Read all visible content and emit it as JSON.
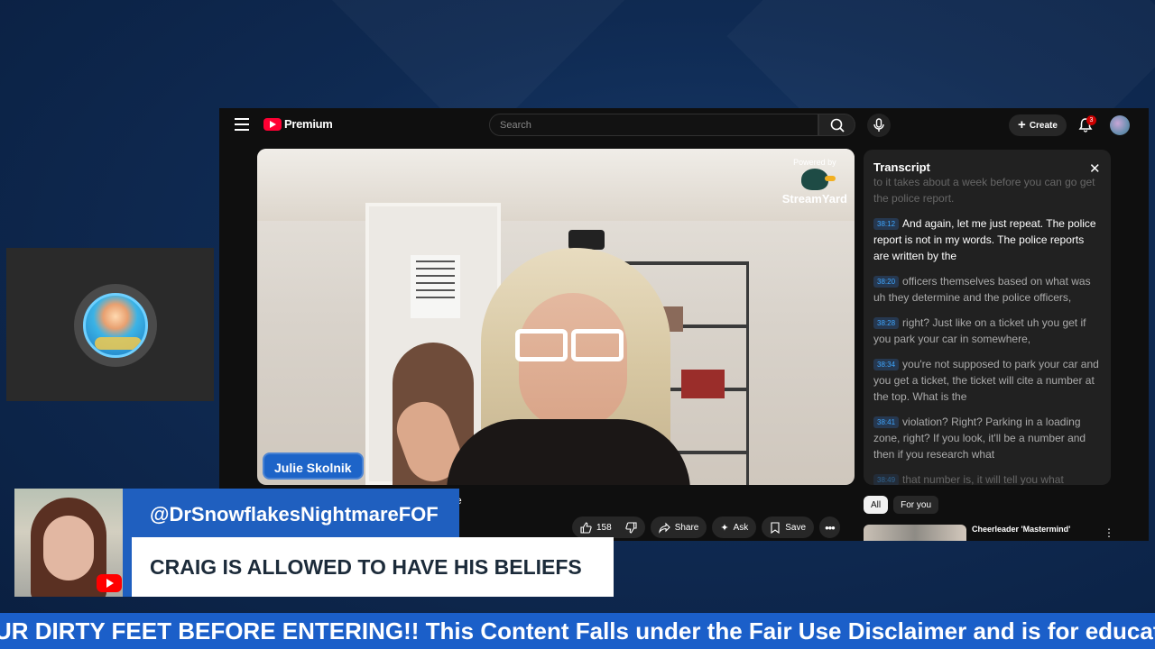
{
  "youtube": {
    "logo_text": "Premium",
    "search_placeholder": "Search",
    "create_label": "Create",
    "notification_count": "3",
    "video": {
      "watermark_top": "Powered by",
      "watermark_name": "StreamYard",
      "name_tag": "Julie Skolnik",
      "title_tail": "e"
    },
    "actions": {
      "like_count": "158",
      "share_label": "Share",
      "ask_label": "Ask",
      "save_label": "Save"
    },
    "transcript": {
      "title": "Transcript",
      "segments": [
        {
          "time": "",
          "text": "to it takes about a week before you can go get the police report."
        },
        {
          "time": "38:12",
          "text": "And again, let me just repeat. The police report is not in my words. The police reports are written by the"
        },
        {
          "time": "38:20",
          "text": "officers themselves based on what was uh they determine and the police officers,"
        },
        {
          "time": "38:28",
          "text": "right? Just like on a ticket uh you get if you park your car in somewhere,"
        },
        {
          "time": "38:34",
          "text": "you're not supposed to park your car and you get a ticket, the ticket will cite a number at the top. What is the"
        },
        {
          "time": "38:41",
          "text": "violation? Right? Parking in a loading zone, right? If you look, it'll be a number and then if you research what"
        },
        {
          "time": "38:49",
          "text": "that number is, it will tell you what"
        }
      ],
      "chips": [
        "All",
        "For you"
      ]
    },
    "recommendation": {
      "title": "Cheerleader 'Mastermind'"
    }
  },
  "overlay": {
    "handle": "@DrSnowflakesNightmareFOF",
    "message": "CRAIG IS ALLOWED TO HAVE HIS BELIEFS",
    "ticker": "UR DIRTY FEET BEFORE ENTERING!! This Content Falls under the Fair Use Disclaimer and is for educationa"
  },
  "colors": {
    "background": "#0f2a52",
    "overlay_blue": "#1f5fbf",
    "ticker_blue": "#1b5fc9",
    "youtube_red": "#ff0033",
    "timestamp_blue": "#3ea6ff"
  },
  "icons": [
    "hamburger-icon",
    "youtube-logo-icon",
    "search-icon",
    "mic-icon",
    "plus-icon",
    "bell-icon",
    "close-icon",
    "thumbs-up-icon",
    "thumbs-down-icon",
    "share-icon",
    "ask-sparkle-icon",
    "save-icon",
    "more-icon",
    "kebab-icon",
    "youtube-badge-icon"
  ]
}
